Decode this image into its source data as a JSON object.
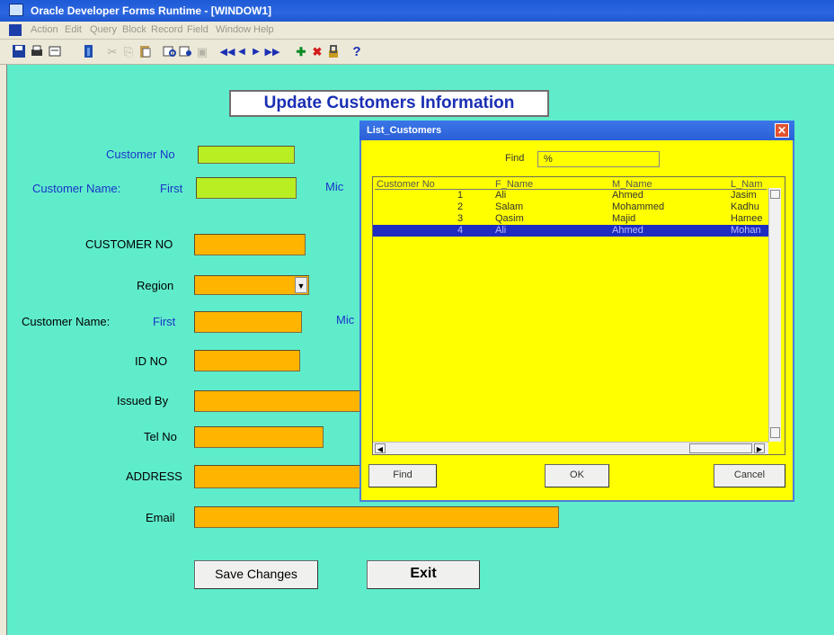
{
  "window": {
    "title": "Oracle Developer Forms Runtime - [WINDOW1]",
    "menu": [
      "Action",
      "Edit",
      "Query",
      "Block",
      "Record",
      "Field",
      "Window",
      "Help"
    ]
  },
  "toolbar": {
    "icons": [
      "save-icon",
      "print-icon",
      "clear-icon",
      "exit-icon",
      "cut-icon",
      "copy-icon",
      "paste-icon",
      "enter-query-icon",
      "execute-query-icon",
      "cancel-query-icon",
      "first-record-icon",
      "previous-record-icon",
      "next-record-icon",
      "last-record-icon",
      "insert-record-icon",
      "delete-record-icon",
      "lock-record-icon",
      "help-icon"
    ],
    "help_label": "?"
  },
  "form": {
    "header": "Update Customers Information",
    "customer_no_label": "Customer No",
    "customer_name_label": "Customer Name:",
    "first_label": "First",
    "middle_label_partial": "Mic",
    "customer_no_upper_label": "CUSTOMER NO",
    "region_label": "Region",
    "id_no_label": "ID NO",
    "issued_by_label": "Issued By",
    "tel_no_label": "Tel No",
    "address_label": "ADDRESS",
    "email_label": "Email",
    "save_button": "Save Changes",
    "exit_button": "Exit"
  },
  "dialog": {
    "title": "List_Customers",
    "find_label": "Find",
    "find_value": "%",
    "columns": [
      "Customer No",
      "F_Name",
      "M_Name",
      "L_Nam"
    ],
    "rows": [
      {
        "no": "1",
        "f": "Ali",
        "m": "Ahmed",
        "l": "Jasim"
      },
      {
        "no": "2",
        "f": "Salam",
        "m": "Mohammed",
        "l": "Kadhu"
      },
      {
        "no": "3",
        "f": "Qasim",
        "m": "Majid",
        "l": "Hamee"
      },
      {
        "no": "4",
        "f": "Ali",
        "m": "Ahmed",
        "l": "Mohan"
      }
    ],
    "selected_row": 3,
    "find_button": "Find",
    "ok_button": "OK",
    "cancel_button": "Cancel"
  },
  "colors": {
    "background": "#5feccb",
    "title_bar": "#2c67e0",
    "lime_field": "#b9ee23",
    "orange_field": "#ffb500",
    "dialog_bg": "#ffff00",
    "selection": "#1e2cc0"
  }
}
